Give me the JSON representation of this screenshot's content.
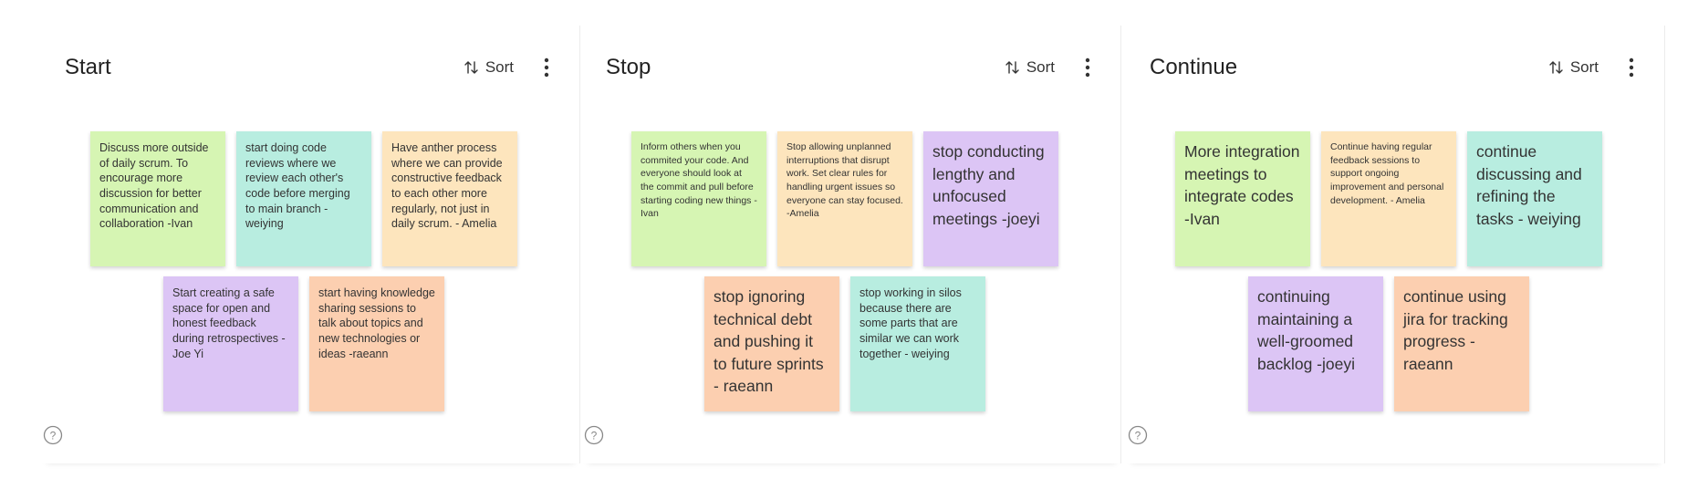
{
  "columns": [
    {
      "title": "Start",
      "sort_label": "Sort",
      "notes": [
        {
          "text": "Discuss more outside of daily scrum. To encourage more discussion for better communication and collaboration -Ivan",
          "color": "#d6f5b3"
        },
        {
          "text": "start doing code reviews where we review each other's code before merging to main branch - weiying",
          "color": "#b8ede0"
        },
        {
          "text": "Have anther process where we can provide constructive feedback to each other more regularly, not just in daily scrum. - Amelia",
          "color": "#fde5bd"
        },
        {
          "text": "Start creating a safe space for open and honest feedback during retrospectives - Joe Yi",
          "color": "#dcc5f5"
        },
        {
          "text": "start having knowledge sharing sessions to talk about topics and new technologies or ideas -raeann",
          "color": "#fccfb0"
        }
      ]
    },
    {
      "title": "Stop",
      "sort_label": "Sort",
      "notes": [
        {
          "text": "Inform others when you commited your code. And everyone should look at the commit and pull before starting coding new things -Ivan",
          "color": "#d6f5b3"
        },
        {
          "text": "Stop allowing unplanned interruptions that disrupt work. Set clear rules for handling urgent issues so everyone can stay focused. -Amelia",
          "color": "#fde5bd"
        },
        {
          "text": "stop conducting lengthy and unfocused meetings -joeyi",
          "color": "#dcc5f5"
        },
        {
          "text": "stop ignoring technical debt and pushing it to future sprints - raeann",
          "color": "#fccfb0"
        },
        {
          "text": "stop working in silos because there are some parts that are similar we can work together - weiying",
          "color": "#b8ede0"
        }
      ]
    },
    {
      "title": "Continue",
      "sort_label": "Sort",
      "notes": [
        {
          "text": "More integration meetings to integrate codes -Ivan",
          "color": "#d6f5b3"
        },
        {
          "text": "Continue having regular feedback sessions to support ongoing improvement and personal development. - Amelia",
          "color": "#fde5bd"
        },
        {
          "text": "continue discussing and refining the tasks - weiying",
          "color": "#b8ede0"
        },
        {
          "text": "continuing maintaining a well-groomed backlog -joeyi",
          "color": "#dcc5f5"
        },
        {
          "text": "continue using jira for tracking progress - raeann",
          "color": "#fccfb0"
        }
      ]
    }
  ],
  "icons": {
    "sort": "sort-icon",
    "menu": "more-vertical-icon",
    "help": "help-circle-icon"
  }
}
